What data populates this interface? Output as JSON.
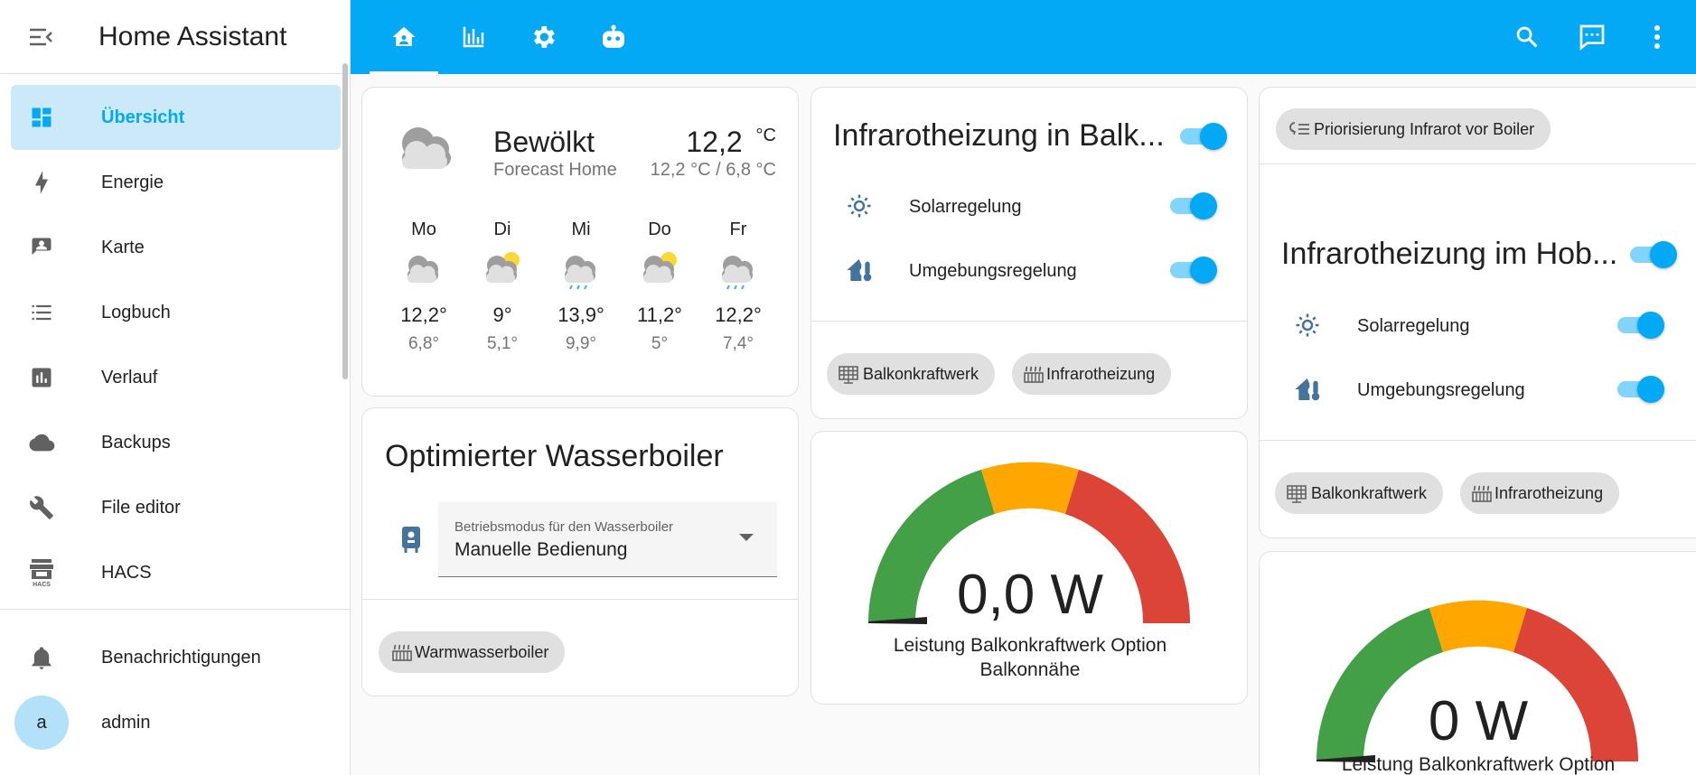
{
  "app": {
    "title": "Home Assistant"
  },
  "sidebar": {
    "items": [
      {
        "label": "Übersicht",
        "icon": "dashboard-icon",
        "active": true
      },
      {
        "label": "Energie",
        "icon": "lightning-bolt-icon"
      },
      {
        "label": "Karte",
        "icon": "map-account-icon"
      },
      {
        "label": "Logbuch",
        "icon": "logbook-list-icon"
      },
      {
        "label": "Verlauf",
        "icon": "history-chart-icon"
      },
      {
        "label": "Backups",
        "icon": "cloud-icon"
      },
      {
        "label": "File editor",
        "icon": "wrench-icon"
      },
      {
        "label": "HACS",
        "icon": "hacs-store-icon"
      }
    ],
    "notifications_label": "Benachrichtigungen",
    "user": {
      "initial": "a",
      "name": "admin"
    }
  },
  "header": {
    "tabs": [
      "home-icon",
      "energy-chart-icon",
      "settings-cog-icon",
      "robot-icon"
    ],
    "actions": [
      "search-icon",
      "assist-chat-icon",
      "more-vertical-icon"
    ]
  },
  "weather": {
    "condition": "Bewölkt",
    "entity": "Forecast Home",
    "temperature": "12,2",
    "unit": "°C",
    "hi_lo": "12,2 °C / 6,8 °C",
    "forecast": [
      {
        "day": "Mo",
        "icon": "cloudy-icon",
        "high": "12,2°",
        "low": "6,8°"
      },
      {
        "day": "Di",
        "icon": "partly-cloudy-icon",
        "high": "9°",
        "low": "5,1°"
      },
      {
        "day": "Mi",
        "icon": "rainy-icon",
        "high": "13,9°",
        "low": "9,9°"
      },
      {
        "day": "Do",
        "icon": "partly-cloudy-icon",
        "high": "11,2°",
        "low": "5°"
      },
      {
        "day": "Fr",
        "icon": "rainy-icon",
        "high": "12,2°",
        "low": "7,4°"
      }
    ]
  },
  "boiler": {
    "title": "Optimierter Wasserboiler",
    "select_label": "Betriebsmodus für den Wasserboiler",
    "select_value": "Manuelle Bedienung",
    "chip": "Warmwasserboiler"
  },
  "balkon_card": {
    "title": "Infrarotheizung in Balk...",
    "rows": [
      "Solarregelung",
      "Umgebungsregelung"
    ],
    "chips": [
      "Balkonkraftwerk",
      "Infrarotheizung"
    ]
  },
  "gauge1": {
    "value": 0.0,
    "display": "0,0 W",
    "name": "Leistung Balkonkraftwerk Option Balkonnähe"
  },
  "priority_chip": "Priorisierung Infrarot vor Boiler",
  "hobby_card": {
    "title": "Infrarotheizung im Hob...",
    "rows": [
      "Solarregelung",
      "Umgebungsregelung"
    ],
    "chips": [
      "Balkonkraftwerk",
      "Infrarotheizung"
    ]
  },
  "gauge2": {
    "value": 0,
    "display": "0 W",
    "name": "Leistung Balkonkraftwerk Option"
  },
  "colors": {
    "primary": "#03a9f4",
    "gauge_green": "#43a047",
    "gauge_yellow": "#ffa600",
    "gauge_red": "#db4437",
    "icon_blue": "#44739e"
  }
}
